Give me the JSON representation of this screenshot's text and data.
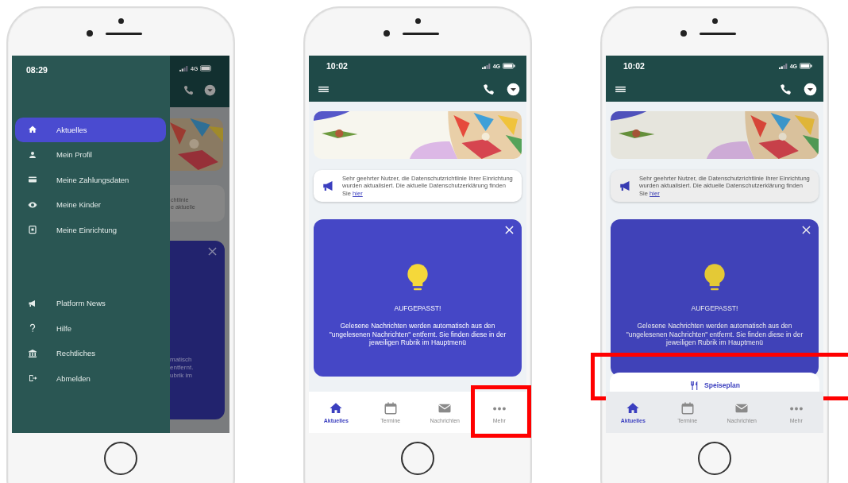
{
  "phones": [
    {
      "kind": "drawer",
      "time": "08:29",
      "network": "4G",
      "drawer": {
        "items": [
          {
            "kind": "home",
            "label": "Aktuelles",
            "selected": true
          },
          {
            "kind": "person",
            "label": "Mein Profil",
            "selected": false
          },
          {
            "kind": "card",
            "label": "Meine Zahlungsdaten",
            "selected": false
          },
          {
            "kind": "eye",
            "label": "Meine Kinder",
            "selected": false
          },
          {
            "kind": "document",
            "label": "Meine Einrichtung",
            "selected": false
          }
        ],
        "footer_items": [
          {
            "kind": "megaphone",
            "label": "Platform News",
            "selected": false
          },
          {
            "kind": "help",
            "label": "Hilfe",
            "selected": false
          },
          {
            "kind": "bank",
            "label": "Rechtliches",
            "selected": false
          },
          {
            "kind": "logout",
            "label": "Abmelden",
            "selected": false
          }
        ]
      },
      "behind": {
        "notice_fragments": [
          "chtlinie",
          "e aktuelle"
        ],
        "card_fragments": [
          "matisch",
          "entfernt.",
          "ubrik im"
        ]
      }
    },
    {
      "kind": "home",
      "time": "10:02",
      "network": "4G",
      "dimmed": false,
      "notice": {
        "text": "Sehr geehrter Nutzer, die Datenschutzrichtlinie Ihrer Einrichtung wurden aktualisiert. Die aktuelle Datenschutzerklärung finden Sie",
        "link": "hier"
      },
      "card": {
        "title": "AUFGEPASST!",
        "body": "Gelesene Nachrichten werden automatisch aus den \"ungelesenen Nachrichten\" entfernt. Sie finden diese in der jeweiligen Rubrik im Hauptmenü"
      },
      "tabs": [
        {
          "kind": "home",
          "label": "Aktuelles",
          "selected": true,
          "highlighted": false
        },
        {
          "kind": "calendar",
          "label": "Termine",
          "selected": false,
          "highlighted": false
        },
        {
          "kind": "mail",
          "label": "Nachrichten",
          "selected": false,
          "highlighted": false
        },
        {
          "kind": "more",
          "label": "Mehr",
          "selected": false,
          "highlighted": true
        }
      ]
    },
    {
      "kind": "home",
      "time": "10:02",
      "network": "4G",
      "dimmed": true,
      "notice": {
        "text": "Sehr geehrter Nutzer, die Datenschutzrichtlinie Ihrer Einrichtung wurden aktualisiert. Die aktuelle Datenschutzerklärung finden Sie",
        "link": "hier"
      },
      "card": {
        "title": "AUFGEPASST!",
        "body": "Gelesene Nachrichten werden automatisch aus den \"ungelesenen Nachrichten\" entfernt. Sie finden diese in der jeweiligen Rubrik im Hauptmenü"
      },
      "sheet": {
        "kind": "cutlery",
        "label": "Speiseplan",
        "highlighted": true
      },
      "tabs": [
        {
          "kind": "home",
          "label": "Aktuelles",
          "selected": true,
          "highlighted": false
        },
        {
          "kind": "calendar",
          "label": "Termine",
          "selected": false,
          "highlighted": false
        },
        {
          "kind": "mail",
          "label": "Nachrichten",
          "selected": false,
          "highlighted": false
        },
        {
          "kind": "more",
          "label": "Mehr",
          "selected": false,
          "highlighted": false
        }
      ]
    }
  ]
}
